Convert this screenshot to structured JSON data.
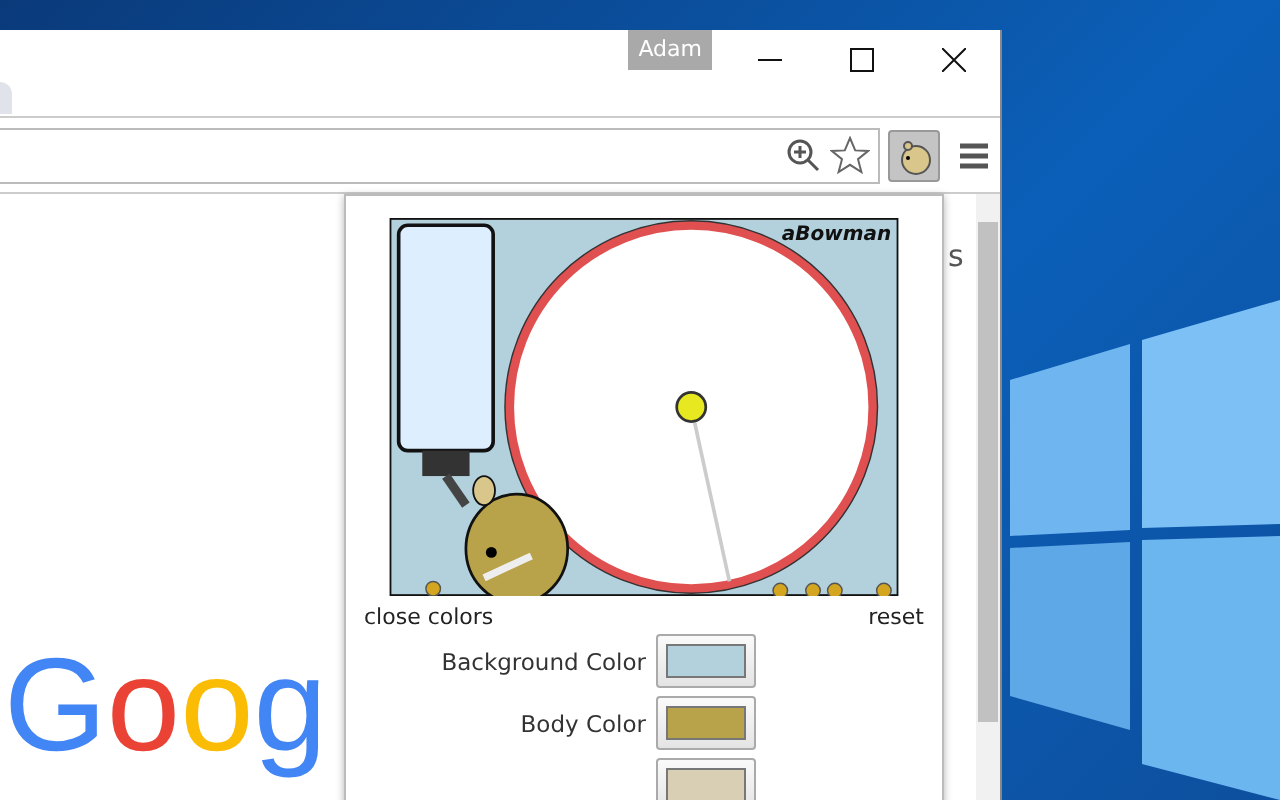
{
  "window": {
    "profile": "Adam"
  },
  "toolbar": {
    "extension_selected": true
  },
  "page": {
    "partial_text": "s",
    "logo_letters": [
      {
        "text": "G",
        "color": "#4285f4"
      },
      {
        "text": "o",
        "color": "#ea4335"
      },
      {
        "text": "o",
        "color": "#fbbc05"
      },
      {
        "text": "g",
        "color": "#4285f4"
      }
    ]
  },
  "popup": {
    "game": {
      "signature": "aBowman"
    },
    "links": [
      "close colors",
      "reset"
    ],
    "colors": [
      {
        "label": "Background Color",
        "color": "#b3d1dd"
      },
      {
        "label": "Body Color",
        "color": "#b8a24a"
      },
      {
        "color": "#d8cfb4"
      }
    ]
  }
}
